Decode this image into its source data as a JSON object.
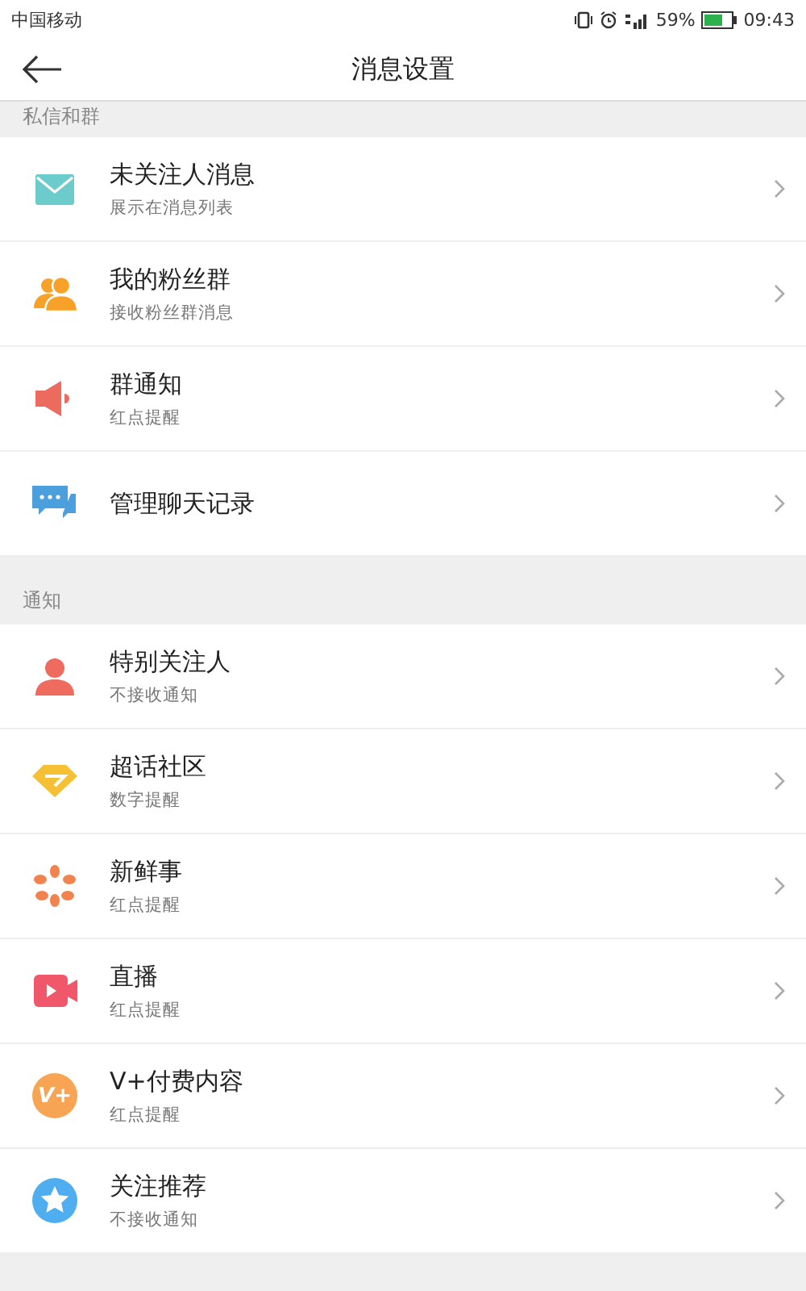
{
  "status_bar": {
    "carrier": "中国移动",
    "battery": "59%",
    "time": "09:43"
  },
  "header": {
    "title": "消息设置"
  },
  "sections": [
    {
      "title": "私信和群",
      "items": [
        {
          "kind": "mail",
          "title": "未关注人消息",
          "subtitle": "展示在消息列表"
        },
        {
          "kind": "group",
          "title": "我的粉丝群",
          "subtitle": "接收粉丝群消息"
        },
        {
          "kind": "speaker",
          "title": "群通知",
          "subtitle": "红点提醒"
        },
        {
          "kind": "chat",
          "title": "管理聊天记录"
        }
      ]
    },
    {
      "title": "通知",
      "items": [
        {
          "kind": "person",
          "title": "特别关注人",
          "subtitle": "不接收通知"
        },
        {
          "kind": "diamond",
          "title": "超话社区",
          "subtitle": "数字提醒"
        },
        {
          "kind": "flower",
          "title": "新鲜事",
          "subtitle": "红点提醒"
        },
        {
          "kind": "video",
          "title": "直播",
          "subtitle": "红点提醒"
        },
        {
          "kind": "badge",
          "icon_text": "V+",
          "title": "V+付费内容",
          "subtitle": "红点提醒"
        },
        {
          "kind": "star",
          "title": "关注推荐",
          "subtitle": "不接收通知"
        }
      ]
    }
  ]
}
